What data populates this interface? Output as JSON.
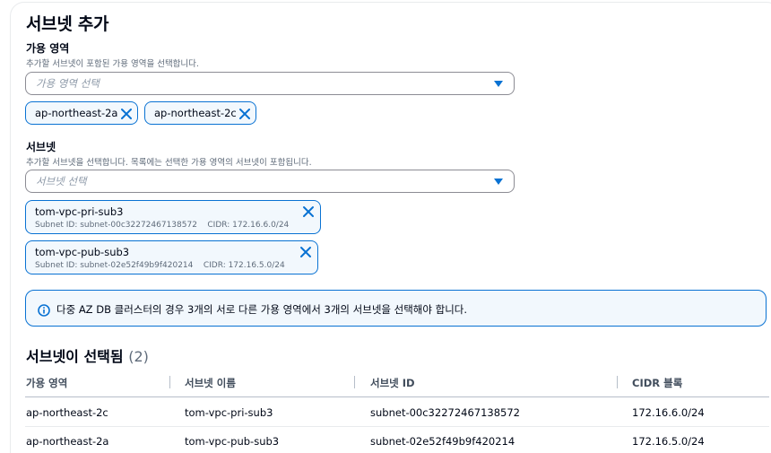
{
  "title": "서브넷 추가",
  "az": {
    "label": "가용 영역",
    "description": "추가할 서브넷이 포함된 가용 영역을 선택합니다.",
    "placeholder": "가용 영역 선택",
    "tokens": [
      "ap-northeast-2a",
      "ap-northeast-2c"
    ]
  },
  "subnet": {
    "label": "서브넷",
    "description": "추가할 서브넷을 선택합니다. 목록에는 선택한 가용 영역의 서브넷이 포함됩니다.",
    "placeholder": "서브넷 선택",
    "tokens": [
      {
        "name": "tom-vpc-pri-sub3",
        "subnet_id": "Subnet ID: subnet-00c32272467138572",
        "cidr": "CIDR: 172.16.6.0/24"
      },
      {
        "name": "tom-vpc-pub-sub3",
        "subnet_id": "Subnet ID: subnet-02e52f49b9f420214",
        "cidr": "CIDR: 172.16.5.0/24"
      }
    ]
  },
  "alert": {
    "text": "다중 AZ DB 클러스터의 경우 3개의 서로 다른 가용 영역에서 3개의 서브넷을 선택해야 합니다."
  },
  "selected": {
    "heading": "서브넷이 선택됨",
    "count": "(2)",
    "columns": [
      "가용 영역",
      "서브넷 이름",
      "서브넷 ID",
      "CIDR 블록"
    ],
    "rows": [
      [
        "ap-northeast-2c",
        "tom-vpc-pri-sub3",
        "subnet-00c32272467138572",
        "172.16.6.0/24"
      ],
      [
        "ap-northeast-2a",
        "tom-vpc-pub-sub3",
        "subnet-02e52f49b9f420214",
        "172.16.5.0/24"
      ]
    ]
  },
  "colors": {
    "accent": "#0972d3",
    "token_bg": "#f2f8fd",
    "text": "#000716",
    "muted": "#5f6b7a"
  },
  "icons": [
    "caret-down-icon",
    "dismiss-icon",
    "info-icon"
  ]
}
